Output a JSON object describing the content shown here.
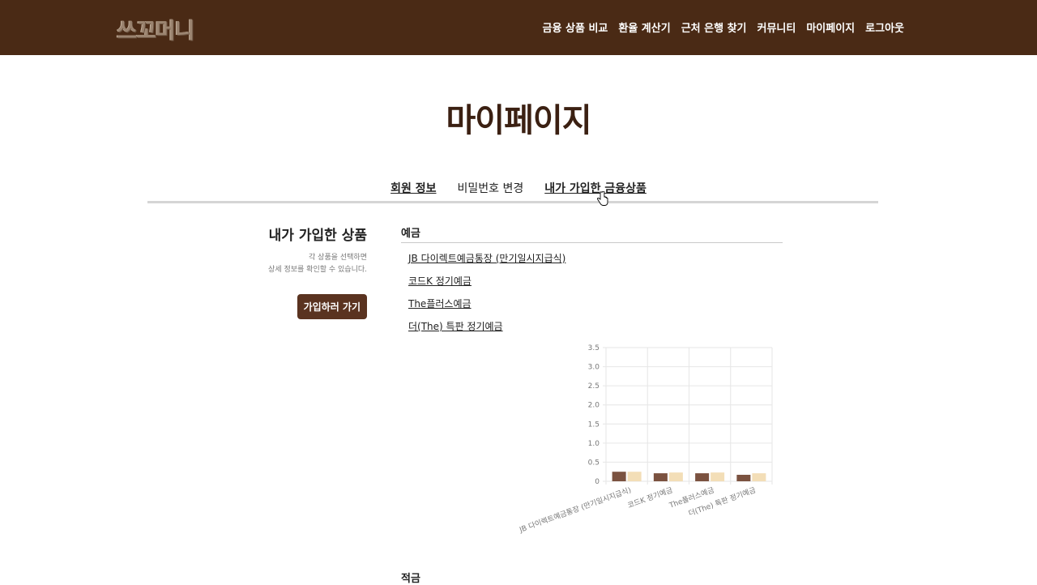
{
  "header": {
    "logo": "쓰꼬머니",
    "nav": [
      "금융 상품 비교",
      "환율 계산기",
      "근처 은행 찾기",
      "커뮤니티",
      "마이페이지",
      "로그아웃"
    ]
  },
  "page_title": "마이페이지",
  "tabs": [
    "회원 정보",
    "비밀번호 변경",
    "내가 가입한 금융상품"
  ],
  "sidebar": {
    "title": "내가 가입한 상품",
    "desc_line1": "각 상품을 선택하면",
    "desc_line2": "상세 정보를 확인할 수 있습니다.",
    "button": "가입하러 가기"
  },
  "deposit": {
    "title": "예금",
    "products": [
      "JB 다이렉트예금통장 (만기일시지급식)",
      "코드K 정기예금",
      "The플러스예금",
      "더(The) 특판 정기예금"
    ]
  },
  "savings": {
    "title": "적금"
  },
  "colors": {
    "series_a": "#7b5240",
    "series_b": "#f3deb7",
    "header_bg": "#4a2a15"
  },
  "chart_data": {
    "type": "bar",
    "categories": [
      "JB 다이렉트예금통장 (만기일시지급식)",
      "코드K 정기예금",
      "The플러스예금",
      "더(The) 특판 정기예금"
    ],
    "series": [
      {
        "values": [
          0.25,
          0.21,
          0.21,
          0.17
        ],
        "color": "#7b5240"
      },
      {
        "values": [
          0.25,
          0.23,
          0.23,
          0.21
        ],
        "color": "#f3deb7"
      }
    ],
    "ylim": [
      0,
      3.5
    ],
    "yticks": [
      "0",
      "0.5",
      "1.0",
      "1.5",
      "2.0",
      "2.5",
      "3.0",
      "3.5"
    ],
    "grid": true
  }
}
